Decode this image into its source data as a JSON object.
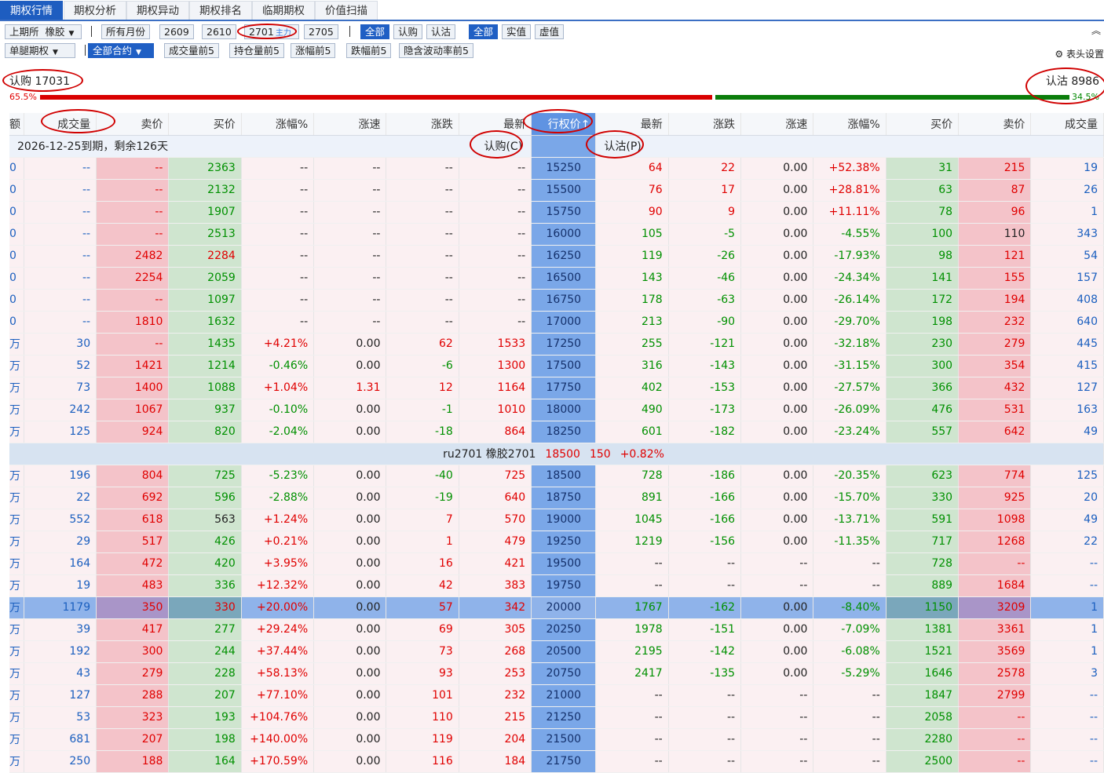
{
  "tabs": [
    "期权行情",
    "期权分析",
    "期权异动",
    "期权排名",
    "临期期权",
    "价值扫描"
  ],
  "toolbar": {
    "exchange": "上期所",
    "variety": "橡胶",
    "months": [
      "所有月份",
      "2609",
      "2610",
      "2701",
      "2705"
    ],
    "main_tag": "主力",
    "type_filter": [
      "全部",
      "认购",
      "认沽"
    ],
    "value_filter": [
      "全部",
      "实值",
      "虚值"
    ],
    "option_kind": "单腿期权",
    "contract_filter": "全部合约",
    "rank_filters": [
      "成交量前5",
      "持仓量前5",
      "涨幅前5",
      "跌幅前5",
      "隐含波动率前5"
    ],
    "column_settings": "表头设置"
  },
  "ratio": {
    "call_label": "认购 17031",
    "put_label": "认沽 8986",
    "call_pct": "65.5%",
    "put_pct": "34.5%",
    "call_fraction": 0.655,
    "put_fraction": 0.345
  },
  "columns": [
    "额",
    "成交量",
    "卖价",
    "买价",
    "涨幅%",
    "涨速",
    "涨跌",
    "最新",
    "行权价↑",
    "最新",
    "涨跌",
    "涨速",
    "涨幅%",
    "买价",
    "卖价",
    "成交量"
  ],
  "expiry": {
    "text": "2026-12-25到期，剩余126天",
    "call_label": "认购(C)",
    "put_label": "认沽(P)"
  },
  "future": {
    "code": "ru2701 橡胶2701",
    "price": "18500",
    "change": "150",
    "pct": "+0.82%"
  },
  "rows": [
    {
      "c": [
        "0",
        "--",
        "--",
        "2363",
        "--",
        "--",
        "--",
        "--"
      ],
      "k": "15250",
      "p": [
        "64",
        "22",
        "0.00",
        "+52.38%",
        "31",
        "215",
        "19"
      ]
    },
    {
      "c": [
        "0",
        "--",
        "--",
        "2132",
        "--",
        "--",
        "--",
        "--"
      ],
      "k": "15500",
      "p": [
        "76",
        "17",
        "0.00",
        "+28.81%",
        "63",
        "87",
        "26"
      ]
    },
    {
      "c": [
        "0",
        "--",
        "--",
        "1907",
        "--",
        "--",
        "--",
        "--"
      ],
      "k": "15750",
      "p": [
        "90",
        "9",
        "0.00",
        "+11.11%",
        "78",
        "96",
        "1"
      ]
    },
    {
      "c": [
        "0",
        "--",
        "--",
        "2513",
        "--",
        "--",
        "--",
        "--"
      ],
      "k": "16000",
      "p": [
        "105",
        "-5",
        "0.00",
        "-4.55%",
        "100",
        "110",
        "343"
      ]
    },
    {
      "c": [
        "0",
        "--",
        "2482",
        "2284",
        "--",
        "--",
        "--",
        "--"
      ],
      "k": "16250",
      "p": [
        "119",
        "-26",
        "0.00",
        "-17.93%",
        "98",
        "121",
        "54"
      ]
    },
    {
      "c": [
        "0",
        "--",
        "2254",
        "2059",
        "--",
        "--",
        "--",
        "--"
      ],
      "k": "16500",
      "p": [
        "143",
        "-46",
        "0.00",
        "-24.34%",
        "141",
        "155",
        "157"
      ]
    },
    {
      "c": [
        "0",
        "--",
        "--",
        "1097",
        "--",
        "--",
        "--",
        "--"
      ],
      "k": "16750",
      "p": [
        "178",
        "-63",
        "0.00",
        "-26.14%",
        "172",
        "194",
        "408"
      ]
    },
    {
      "c": [
        "0",
        "--",
        "1810",
        "1632",
        "--",
        "--",
        "--",
        "--"
      ],
      "k": "17000",
      "p": [
        "213",
        "-90",
        "0.00",
        "-29.70%",
        "198",
        "232",
        "640"
      ]
    },
    {
      "c": [
        "万",
        "30",
        "--",
        "1435",
        "+4.21%",
        "0.00",
        "62",
        "1533"
      ],
      "k": "17250",
      "p": [
        "255",
        "-121",
        "0.00",
        "-32.18%",
        "230",
        "279",
        "445"
      ]
    },
    {
      "c": [
        "万",
        "52",
        "1421",
        "1214",
        "-0.46%",
        "0.00",
        "-6",
        "1300"
      ],
      "k": "17500",
      "p": [
        "316",
        "-143",
        "0.00",
        "-31.15%",
        "300",
        "354",
        "415"
      ]
    },
    {
      "c": [
        "万",
        "73",
        "1400",
        "1088",
        "+1.04%",
        "1.31",
        "12",
        "1164"
      ],
      "k": "17750",
      "p": [
        "402",
        "-153",
        "0.00",
        "-27.57%",
        "366",
        "432",
        "127"
      ]
    },
    {
      "c": [
        "万",
        "242",
        "1067",
        "937",
        "-0.10%",
        "0.00",
        "-1",
        "1010"
      ],
      "k": "18000",
      "p": [
        "490",
        "-173",
        "0.00",
        "-26.09%",
        "476",
        "531",
        "163"
      ]
    },
    {
      "c": [
        "万",
        "125",
        "924",
        "820",
        "-2.04%",
        "0.00",
        "-18",
        "864"
      ],
      "k": "18250",
      "p": [
        "601",
        "-182",
        "0.00",
        "-23.24%",
        "557",
        "642",
        "49"
      ]
    },
    {
      "future": true
    },
    {
      "c": [
        "万",
        "196",
        "804",
        "725",
        "-5.23%",
        "0.00",
        "-40",
        "725"
      ],
      "k": "18500",
      "p": [
        "728",
        "-186",
        "0.00",
        "-20.35%",
        "623",
        "774",
        "125"
      ]
    },
    {
      "c": [
        "万",
        "22",
        "692",
        "596",
        "-2.88%",
        "0.00",
        "-19",
        "640"
      ],
      "k": "18750",
      "p": [
        "891",
        "-166",
        "0.00",
        "-15.70%",
        "330",
        "925",
        "20"
      ]
    },
    {
      "c": [
        "万",
        "552",
        "618",
        "563",
        "+1.24%",
        "0.00",
        "7",
        "570"
      ],
      "k": "19000",
      "p": [
        "1045",
        "-166",
        "0.00",
        "-13.71%",
        "591",
        "1098",
        "49"
      ]
    },
    {
      "c": [
        "万",
        "29",
        "517",
        "426",
        "+0.21%",
        "0.00",
        "1",
        "479"
      ],
      "k": "19250",
      "p": [
        "1219",
        "-156",
        "0.00",
        "-11.35%",
        "717",
        "1268",
        "22"
      ]
    },
    {
      "c": [
        "万",
        "164",
        "472",
        "420",
        "+3.95%",
        "0.00",
        "16",
        "421"
      ],
      "k": "19500",
      "p": [
        "--",
        "--",
        "--",
        "--",
        "728",
        "--",
        "--"
      ]
    },
    {
      "c": [
        "万",
        "19",
        "483",
        "336",
        "+12.32%",
        "0.00",
        "42",
        "383"
      ],
      "k": "19750",
      "p": [
        "--",
        "--",
        "--",
        "--",
        "889",
        "1684",
        "--"
      ]
    },
    {
      "c": [
        "万",
        "1179",
        "350",
        "330",
        "+20.00%",
        "0.00",
        "57",
        "342"
      ],
      "k": "20000",
      "p": [
        "1767",
        "-162",
        "0.00",
        "-8.40%",
        "1150",
        "3209",
        "1"
      ],
      "hl": true
    },
    {
      "c": [
        "万",
        "39",
        "417",
        "277",
        "+29.24%",
        "0.00",
        "69",
        "305"
      ],
      "k": "20250",
      "p": [
        "1978",
        "-151",
        "0.00",
        "-7.09%",
        "1381",
        "3361",
        "1"
      ]
    },
    {
      "c": [
        "万",
        "192",
        "300",
        "244",
        "+37.44%",
        "0.00",
        "73",
        "268"
      ],
      "k": "20500",
      "p": [
        "2195",
        "-142",
        "0.00",
        "-6.08%",
        "1521",
        "3569",
        "1"
      ]
    },
    {
      "c": [
        "万",
        "43",
        "279",
        "228",
        "+58.13%",
        "0.00",
        "93",
        "253"
      ],
      "k": "20750",
      "p": [
        "2417",
        "-135",
        "0.00",
        "-5.29%",
        "1646",
        "2578",
        "3"
      ]
    },
    {
      "c": [
        "万",
        "127",
        "288",
        "207",
        "+77.10%",
        "0.00",
        "101",
        "232"
      ],
      "k": "21000",
      "p": [
        "--",
        "--",
        "--",
        "--",
        "1847",
        "2799",
        "--"
      ]
    },
    {
      "c": [
        "万",
        "53",
        "323",
        "193",
        "+104.76%",
        "0.00",
        "110",
        "215"
      ],
      "k": "21250",
      "p": [
        "--",
        "--",
        "--",
        "--",
        "2058",
        "--",
        "--"
      ]
    },
    {
      "c": [
        "万",
        "681",
        "207",
        "198",
        "+140.00%",
        "0.00",
        "119",
        "204"
      ],
      "k": "21500",
      "p": [
        "--",
        "--",
        "--",
        "--",
        "2280",
        "--",
        "--"
      ]
    },
    {
      "c": [
        "万",
        "250",
        "188",
        "164",
        "+170.59%",
        "0.00",
        "116",
        "184"
      ],
      "k": "21750",
      "p": [
        "--",
        "--",
        "--",
        "--",
        "2500",
        "--",
        "--"
      ]
    }
  ]
}
